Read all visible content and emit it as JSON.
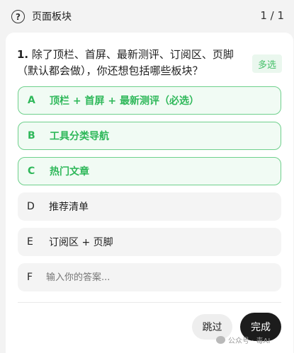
{
  "header": {
    "help_icon": "question-circle-icon",
    "title": "页面板块",
    "count": "1 / 1"
  },
  "question": {
    "number": "1.",
    "text": "除了顶栏、首屏、最新测评、订阅区、页脚（默认都会做），你还想包括哪些板块？",
    "badge": "多选"
  },
  "options": [
    {
      "letter": "A",
      "text": "顶栏 + 首屏 + 最新测评（必选）",
      "selected": true
    },
    {
      "letter": "B",
      "text": "工具分类导航",
      "selected": true
    },
    {
      "letter": "C",
      "text": "热门文章",
      "selected": true
    },
    {
      "letter": "D",
      "text": "推荐清单",
      "selected": false
    },
    {
      "letter": "E",
      "text": "订阅区 + 页脚",
      "selected": false
    },
    {
      "letter": "F",
      "input_value": "",
      "placeholder": "输入你的答案...",
      "selected": false
    }
  ],
  "actions": {
    "skip_label": "跳过",
    "done_label": "完成"
  },
  "watermark": {
    "icon": "wechat-icon",
    "text": "公众号 · 毒AI"
  },
  "colors": {
    "accent_green": "#2fb85a",
    "selected_bg": "#f1fbf4",
    "done_button_bg": "#1c1c1c"
  }
}
